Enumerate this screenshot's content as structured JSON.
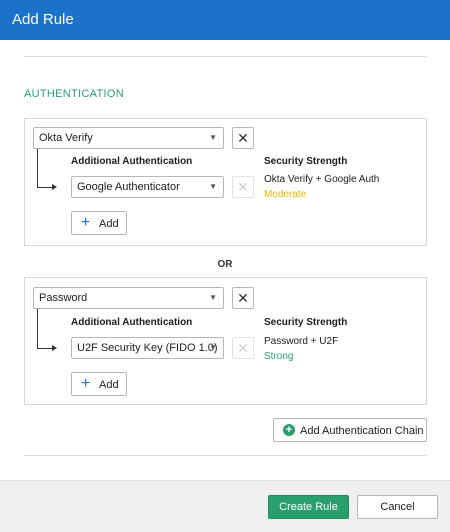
{
  "dialog": {
    "title": "Add Rule"
  },
  "section": {
    "title": "AUTHENTICATION"
  },
  "chains": [
    {
      "primary_factor": "Okta Verify",
      "additional_label": "Additional Authentication",
      "additional_factor": "Google Authenticator",
      "strength_label": "Security Strength",
      "strength_factors": "Okta Verify + Google Auth",
      "strength_level": "Moderate",
      "add_label": "Add"
    },
    {
      "primary_factor": "Password",
      "additional_label": "Additional Authentication",
      "additional_factor": "U2F Security Key (FIDO 1.0)",
      "strength_label": "Security Strength",
      "strength_factors": "Password + U2F",
      "strength_level": "Strong",
      "add_label": "Add"
    }
  ],
  "separator": "OR",
  "add_chain_label": "Add Authentication Chain",
  "footer": {
    "create_label": "Create Rule",
    "cancel_label": "Cancel"
  },
  "colors": {
    "header": "#1a73c9",
    "accent_green": "#2a9f6e",
    "moderate": "#e5b800"
  },
  "icons": {
    "close": "close-icon",
    "dropdown": "caret-down-icon",
    "add": "plus-icon",
    "add_chain": "plus-circle-icon",
    "connector": "arrow-right-icon"
  }
}
